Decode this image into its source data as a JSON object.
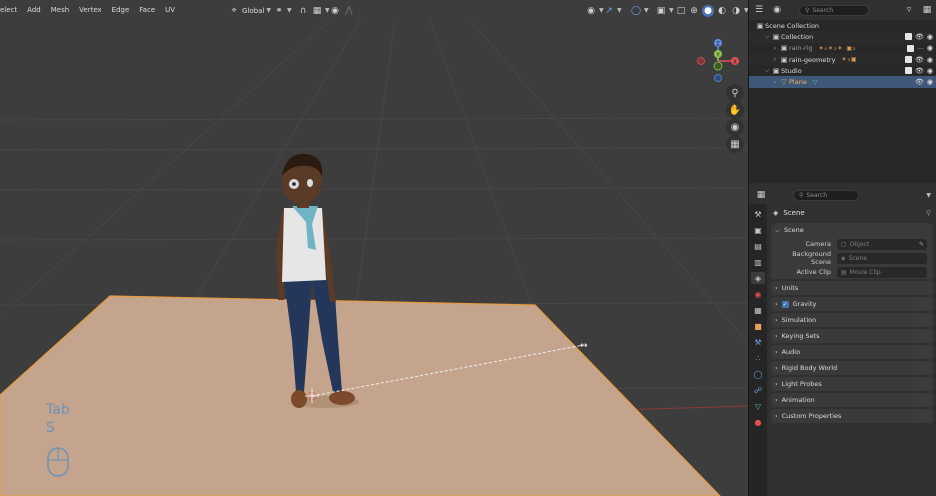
{
  "viewport": {
    "menu": [
      "elect",
      "Add",
      "Mesh",
      "Vertex",
      "Edge",
      "Face",
      "UV"
    ],
    "transform_orientation": "Global",
    "axes": {
      "x": "X",
      "y": "Y",
      "z": "Z"
    },
    "overlay_text": {
      "line1": "Tab",
      "line2": "S"
    }
  },
  "outliner": {
    "search_placeholder": "Search",
    "rows": [
      {
        "label": "Scene Collection",
        "icon": "scene-collection-icon",
        "depth": 0
      },
      {
        "label": "Collection",
        "icon": "collection-icon",
        "depth": 1,
        "expanded": true
      },
      {
        "label": "rain-rig",
        "icon": "collection-icon",
        "depth": 2,
        "dimmed": true,
        "extra": "✶₀✶₂✶ ▣₂"
      },
      {
        "label": "rain-geometry",
        "icon": "collection-icon",
        "depth": 2,
        "extra": "✶₃▣"
      },
      {
        "label": "Studio",
        "icon": "collection-icon",
        "depth": 1,
        "expanded": true
      },
      {
        "label": "Plane",
        "icon": "mesh-icon",
        "depth": 2,
        "selected": true,
        "extra": "▽"
      }
    ]
  },
  "properties": {
    "search_placeholder": "Search",
    "title": "Scene",
    "panel_scene": {
      "title": "Scene",
      "camera_label": "Camera",
      "camera_placeholder": "Object",
      "background_label": "Background Scene",
      "background_placeholder": "Scene",
      "clip_label": "Active Clip",
      "clip_placeholder": "Movie Clip"
    },
    "subpanels": [
      "Units",
      "Gravity",
      "Simulation",
      "Keying Sets",
      "Audio",
      "Rigid Body World",
      "Light Probes",
      "Animation",
      "Custom Properties"
    ],
    "gravity_checked": true
  },
  "colors": {
    "accent_selection": "#3f5778",
    "viewport_bg": "#3d3d3d",
    "floor": "#c4a48c",
    "tab_overlay": "#6d93b5"
  }
}
